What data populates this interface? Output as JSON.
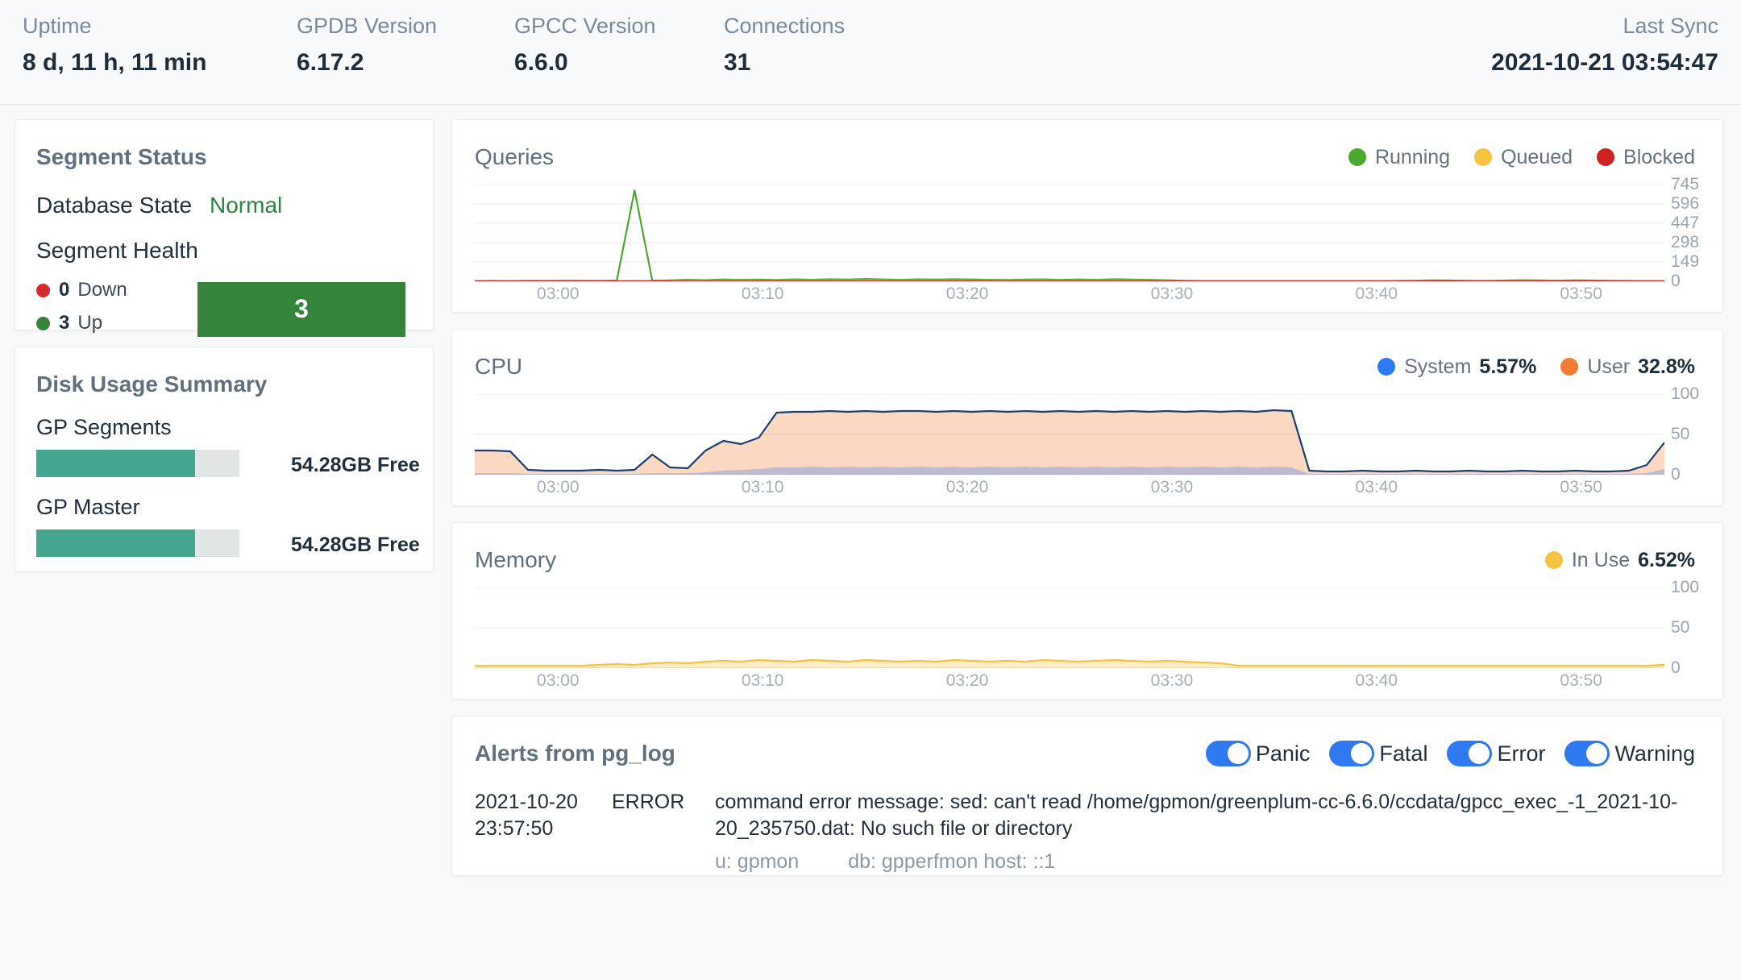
{
  "header": {
    "stats": [
      {
        "label": "Uptime",
        "value": "8 d, 11 h, 11 min"
      },
      {
        "label": "GPDB Version",
        "value": "6.17.2"
      },
      {
        "label": "GPCC Version",
        "value": "6.6.0"
      },
      {
        "label": "Connections",
        "value": "31"
      }
    ],
    "last_sync": {
      "label": "Last Sync",
      "value": "2021-10-21 03:54:47"
    }
  },
  "segment_status": {
    "title": "Segment Status",
    "database_state_label": "Database State",
    "database_state_value": "Normal",
    "database_state_color": "#2e8540",
    "segment_health_label": "Segment Health",
    "down": {
      "count": "0",
      "label": "Down",
      "color": "#d62b2b"
    },
    "up": {
      "count": "3",
      "label": "Up",
      "color": "#35843b"
    },
    "health_bar": {
      "value": "3",
      "color": "#35843b"
    }
  },
  "disk_usage": {
    "title": "Disk Usage Summary",
    "items": [
      {
        "label": "GP Segments",
        "used_pct": 78,
        "free": "54.28GB Free"
      },
      {
        "label": "GP Master",
        "used_pct": 78,
        "free": "54.28GB Free"
      }
    ],
    "bar_color": "#44a68e",
    "track_color": "#e1e5e6"
  },
  "queries_chart": {
    "title": "Queries",
    "legend": [
      {
        "label": "Running",
        "color": "#4ca82e"
      },
      {
        "label": "Queued",
        "color": "#f5c341"
      },
      {
        "label": "Blocked",
        "color": "#cf2222"
      }
    ]
  },
  "cpu_chart": {
    "title": "CPU",
    "legend": [
      {
        "label": "System",
        "value": "5.57%",
        "color": "#2f7af0"
      },
      {
        "label": "User",
        "value": "32.8%",
        "color": "#f07d32"
      }
    ]
  },
  "memory_chart": {
    "title": "Memory",
    "legend": [
      {
        "label": "In Use",
        "value": "6.52%",
        "color": "#f5c341"
      }
    ]
  },
  "alerts": {
    "title": "Alerts from pg_log",
    "toggles": [
      {
        "label": "Panic",
        "on": true
      },
      {
        "label": "Fatal",
        "on": true
      },
      {
        "label": "Error",
        "on": true
      },
      {
        "label": "Warning",
        "on": true
      }
    ],
    "rows": [
      {
        "date": "2021-10-20",
        "time": "23:57:50",
        "severity": "ERROR",
        "message": "command error message: sed: can't read /home/gpmon/greenplum-cc-6.6.0/ccdata/gpcc_exec_-1_2021-10-20_235750.dat: No such file or directory",
        "user": "u: gpmon",
        "db": "db: gpperfmon host: ::1"
      }
    ]
  },
  "chart_data": [
    {
      "type": "line",
      "title": "Queries",
      "xlabel": "",
      "ylabel": "",
      "ylim": [
        0,
        745
      ],
      "yticks": [
        0,
        149,
        298,
        447,
        596,
        745
      ],
      "xticks": [
        "03:00",
        "03:10",
        "03:20",
        "03:30",
        "03:40",
        "03:50"
      ],
      "grid": true,
      "legend_position": "top-right",
      "series": [
        {
          "name": "Running",
          "color": "#4ca82e",
          "values": [
            2,
            3,
            2,
            4,
            3,
            5,
            4,
            3,
            6,
            700,
            5,
            8,
            12,
            9,
            14,
            11,
            13,
            10,
            15,
            12,
            16,
            13,
            18,
            14,
            12,
            15,
            13,
            16,
            14,
            12,
            10,
            13,
            15,
            11,
            14,
            12,
            16,
            13,
            11,
            9,
            4,
            2,
            2,
            2,
            2,
            2,
            2,
            2,
            2,
            2,
            2,
            2,
            3,
            5,
            8,
            6,
            4,
            3,
            6,
            9,
            7,
            5,
            8,
            6,
            4,
            3,
            2,
            2
          ]
        },
        {
          "name": "Queued",
          "color": "#f5c341",
          "values": [
            1,
            1,
            1,
            2,
            1,
            2,
            1,
            1,
            2,
            3,
            2,
            3,
            4,
            3,
            5,
            4,
            4,
            3,
            5,
            4,
            5,
            4,
            6,
            5,
            4,
            5,
            4,
            5,
            4,
            4,
            3,
            4,
            5,
            3,
            4,
            4,
            5,
            4,
            3,
            3,
            1,
            1,
            1,
            1,
            1,
            1,
            1,
            1,
            1,
            1,
            1,
            1,
            1,
            1,
            2,
            1,
            1,
            1,
            2,
            2,
            2,
            1,
            2,
            2,
            1,
            1,
            1,
            1
          ]
        },
        {
          "name": "Blocked",
          "color": "#cf2222",
          "values": [
            0,
            0,
            0,
            0,
            0,
            0,
            0,
            0,
            0,
            0,
            0,
            0,
            0,
            0,
            0,
            0,
            0,
            0,
            0,
            0,
            0,
            0,
            0,
            0,
            0,
            0,
            0,
            0,
            0,
            0,
            0,
            0,
            0,
            0,
            0,
            0,
            0,
            0,
            0,
            0,
            0,
            0,
            0,
            0,
            0,
            0,
            0,
            0,
            0,
            0,
            0,
            0,
            0,
            0,
            0,
            0,
            0,
            0,
            0,
            0,
            0,
            0,
            0,
            0,
            0,
            0,
            0,
            0
          ]
        }
      ]
    },
    {
      "type": "area",
      "title": "CPU",
      "xlabel": "",
      "ylabel": "",
      "ylim": [
        0,
        100
      ],
      "yticks": [
        0,
        50,
        100
      ],
      "xticks": [
        "03:00",
        "03:10",
        "03:20",
        "03:30",
        "03:40",
        "03:50"
      ],
      "grid": true,
      "legend_position": "top-right",
      "series": [
        {
          "name": "User",
          "color": "#f07d32",
          "values": [
            30,
            30,
            29,
            6,
            5,
            5,
            5,
            6,
            5,
            6,
            25,
            9,
            8,
            30,
            42,
            38,
            46,
            77,
            78,
            78,
            79,
            78,
            79,
            78,
            79,
            79,
            78,
            79,
            78,
            79,
            78,
            79,
            78,
            79,
            78,
            79,
            78,
            79,
            78,
            79,
            78,
            79,
            78,
            79,
            78,
            80,
            79,
            5,
            4,
            4,
            5,
            4,
            4,
            5,
            4,
            4,
            5,
            4,
            4,
            5,
            4,
            4,
            5,
            4,
            4,
            5,
            12,
            40
          ]
        },
        {
          "name": "System",
          "color": "#2f7af0",
          "values": [
            2,
            2,
            2,
            1,
            1,
            1,
            1,
            1,
            1,
            1,
            2,
            2,
            2,
            3,
            5,
            6,
            7,
            9,
            9,
            10,
            9,
            10,
            9,
            10,
            9,
            10,
            9,
            10,
            9,
            10,
            9,
            10,
            9,
            10,
            9,
            10,
            9,
            10,
            9,
            10,
            9,
            10,
            9,
            10,
            9,
            10,
            9,
            1,
            1,
            1,
            1,
            1,
            1,
            1,
            1,
            1,
            1,
            1,
            1,
            1,
            1,
            1,
            1,
            1,
            1,
            1,
            2,
            7
          ]
        }
      ]
    },
    {
      "type": "area",
      "title": "Memory",
      "xlabel": "",
      "ylabel": "",
      "ylim": [
        0,
        100
      ],
      "yticks": [
        0,
        50,
        100
      ],
      "xticks": [
        "03:00",
        "03:10",
        "03:20",
        "03:30",
        "03:40",
        "03:50"
      ],
      "grid": true,
      "legend_position": "top-right",
      "series": [
        {
          "name": "In Use",
          "color": "#f5c341",
          "values": [
            3,
            3,
            3,
            3,
            3,
            3,
            3,
            4,
            5,
            4,
            6,
            7,
            6,
            8,
            9,
            8,
            10,
            9,
            8,
            10,
            9,
            8,
            10,
            9,
            8,
            9,
            8,
            10,
            9,
            8,
            9,
            8,
            10,
            9,
            8,
            9,
            10,
            9,
            8,
            9,
            8,
            7,
            6,
            3,
            3,
            3,
            3,
            3,
            3,
            3,
            3,
            3,
            3,
            3,
            3,
            3,
            3,
            3,
            3,
            3,
            3,
            3,
            3,
            3,
            3,
            3,
            3,
            4
          ]
        }
      ]
    }
  ]
}
